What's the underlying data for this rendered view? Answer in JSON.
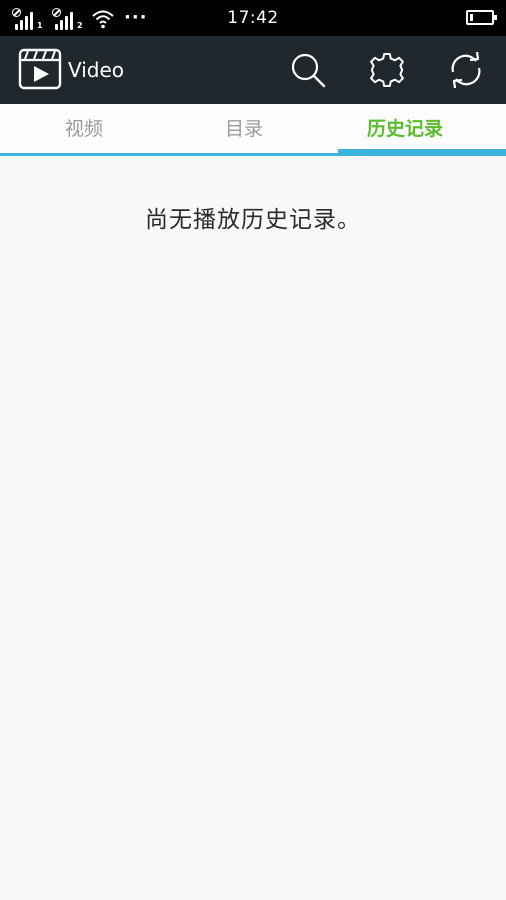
{
  "status_bar": {
    "time": "17:42",
    "sim1_label": "1",
    "sim2_label": "2",
    "more_indicator": "···"
  },
  "app_bar": {
    "title": "Video",
    "logo_icon": "video-clapper-icon",
    "actions": [
      {
        "name": "search-button",
        "icon": "search-icon"
      },
      {
        "name": "settings-button",
        "icon": "gear-icon"
      },
      {
        "name": "refresh-button",
        "icon": "refresh-icon"
      }
    ]
  },
  "tabs": [
    {
      "label": "视频",
      "active": false
    },
    {
      "label": "目录",
      "active": false
    },
    {
      "label": "历史记录",
      "active": true
    }
  ],
  "content": {
    "empty_message": "尚无播放历史记录。"
  },
  "colors": {
    "app_bar_bg": "#20282e",
    "active_tab_text": "#5bbd2e",
    "tab_indicator": "#3bb5dc",
    "inactive_tab_text": "#9a9a9a",
    "page_bg": "#f9f9f9"
  }
}
